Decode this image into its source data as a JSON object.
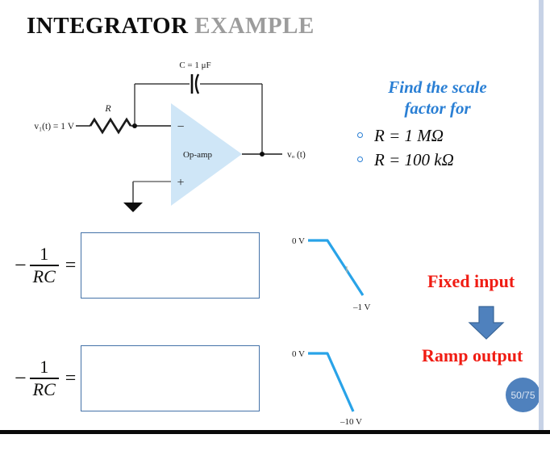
{
  "slide": {
    "title_main": "INTEGRATOR ",
    "title_sub": "EXAMPLE",
    "page_badge": "50/75",
    "accent_blue": "#2a7fd4",
    "opamp_fill": "#cfe6f7",
    "box_border": "#4472a8",
    "red_accent": "#f01c13",
    "arrow_blue": "#4f81bd"
  },
  "circuit": {
    "input_label": "v₁(t) = 1 V",
    "resistor_label": "R",
    "capacitor_label": "C = 1 μF",
    "opamp_label": "Op-amp",
    "minus_terminal": "−",
    "plus_terminal": "+",
    "output_label": "vₒ (t)"
  },
  "question": {
    "heading_line1": "Find the scale",
    "heading_line2": "factor  for",
    "items": [
      {
        "label": "R = 1 MΩ"
      },
      {
        "label": "R = 100 kΩ"
      }
    ]
  },
  "formulas": [
    {
      "minus": "−",
      "numerator": "1",
      "denominator": "RC",
      "equals": "=",
      "answer": ""
    },
    {
      "minus": "−",
      "numerator": "1",
      "denominator": "RC",
      "equals": "=",
      "answer": ""
    }
  ],
  "waveforms": [
    {
      "start_label": "0 V",
      "end_label": "–1 V"
    },
    {
      "start_label": "0 V",
      "end_label": "–10 V"
    }
  ],
  "annotations": {
    "fixed_input": "Fixed input",
    "ramp_output": "Ramp output"
  }
}
